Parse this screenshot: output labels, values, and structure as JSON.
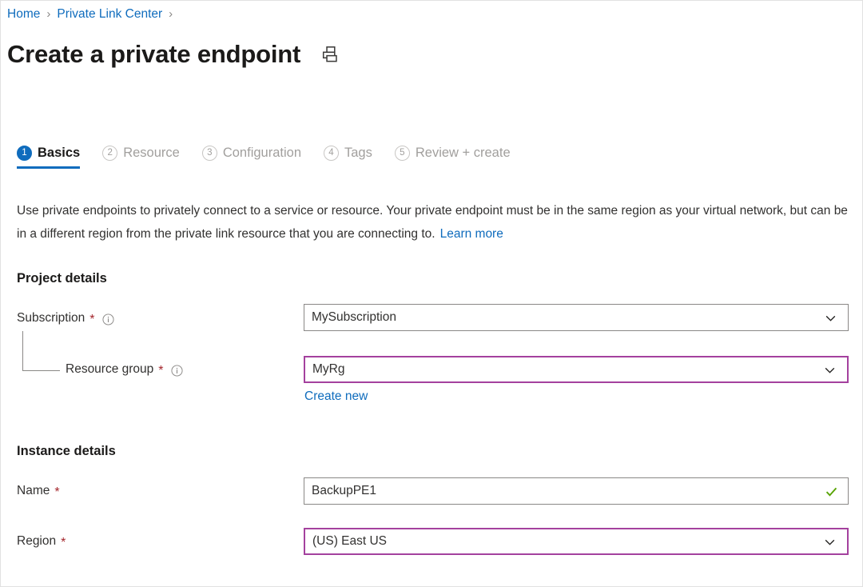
{
  "breadcrumb": {
    "items": [
      {
        "label": "Home"
      },
      {
        "label": "Private Link Center"
      }
    ],
    "separator": "›"
  },
  "header": {
    "title": "Create a private endpoint",
    "print_icon": "printer-icon"
  },
  "tabs": [
    {
      "number": "1",
      "label": "Basics",
      "state": "active"
    },
    {
      "number": "2",
      "label": "Resource",
      "state": "inactive"
    },
    {
      "number": "3",
      "label": "Configuration",
      "state": "inactive"
    },
    {
      "number": "4",
      "label": "Tags",
      "state": "inactive"
    },
    {
      "number": "5",
      "label": "Review + create",
      "state": "inactive"
    }
  ],
  "description": {
    "text": "Use private endpoints to privately connect to a service or resource. Your private endpoint must be in the same region as your virtual network, but can be in a different region from the private link resource that you are connecting to.",
    "link_label": "Learn more"
  },
  "sections": {
    "project": {
      "heading": "Project details",
      "subscription": {
        "label": "Subscription",
        "required": "*",
        "info_icon": "info-icon",
        "value": "MySubscription",
        "chevron_icon": "chevron-down-icon"
      },
      "resource_group": {
        "label": "Resource group",
        "required": "*",
        "info_icon": "info-icon",
        "value": "MyRg",
        "chevron_icon": "chevron-down-icon",
        "create_new_label": "Create new",
        "border_color": "#a4419e"
      }
    },
    "instance": {
      "heading": "Instance details",
      "name": {
        "label": "Name",
        "required": "*",
        "value": "BackupPE1",
        "validation_icon": "check-icon",
        "validation_color": "#57a300"
      },
      "region": {
        "label": "Region",
        "required": "*",
        "value": "(US) East US",
        "chevron_icon": "chevron-down-icon",
        "border_color": "#a4419e"
      }
    }
  },
  "colors": {
    "accent_blue": "#0f6cbd",
    "required_red": "#a4262c",
    "purple_border": "#a4419e",
    "success_green": "#57a300",
    "muted_grey": "#a19f9d"
  }
}
